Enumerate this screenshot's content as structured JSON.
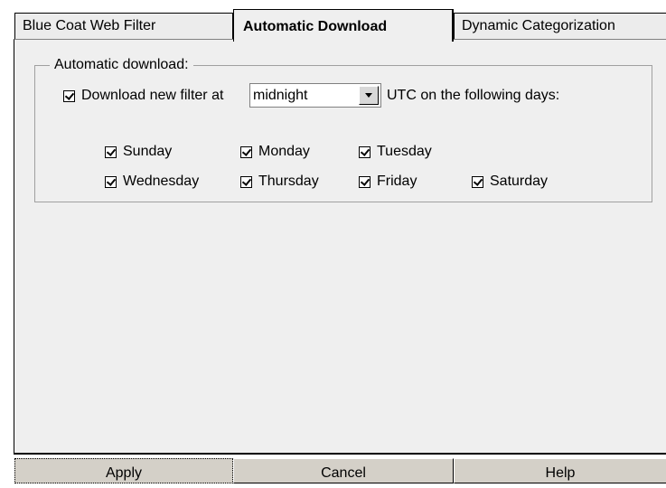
{
  "tabs": [
    {
      "label": "Blue Coat Web Filter",
      "active": false
    },
    {
      "label": "Automatic Download",
      "active": true
    },
    {
      "label": "Dynamic Categorization",
      "active": false
    }
  ],
  "group": {
    "title": "Automatic download:"
  },
  "download": {
    "checked": true,
    "label_before": "Download new filter at",
    "time_value": "midnight",
    "label_after": "UTC on the following days:"
  },
  "days": [
    {
      "label": "Sunday",
      "checked": true
    },
    {
      "label": "Monday",
      "checked": true
    },
    {
      "label": "Tuesday",
      "checked": true
    },
    {
      "label": "Wednesday",
      "checked": true
    },
    {
      "label": "Thursday",
      "checked": true
    },
    {
      "label": "Friday",
      "checked": true
    },
    {
      "label": "Saturday",
      "checked": true
    }
  ],
  "buttons": {
    "apply": "Apply",
    "cancel": "Cancel",
    "help": "Help"
  }
}
